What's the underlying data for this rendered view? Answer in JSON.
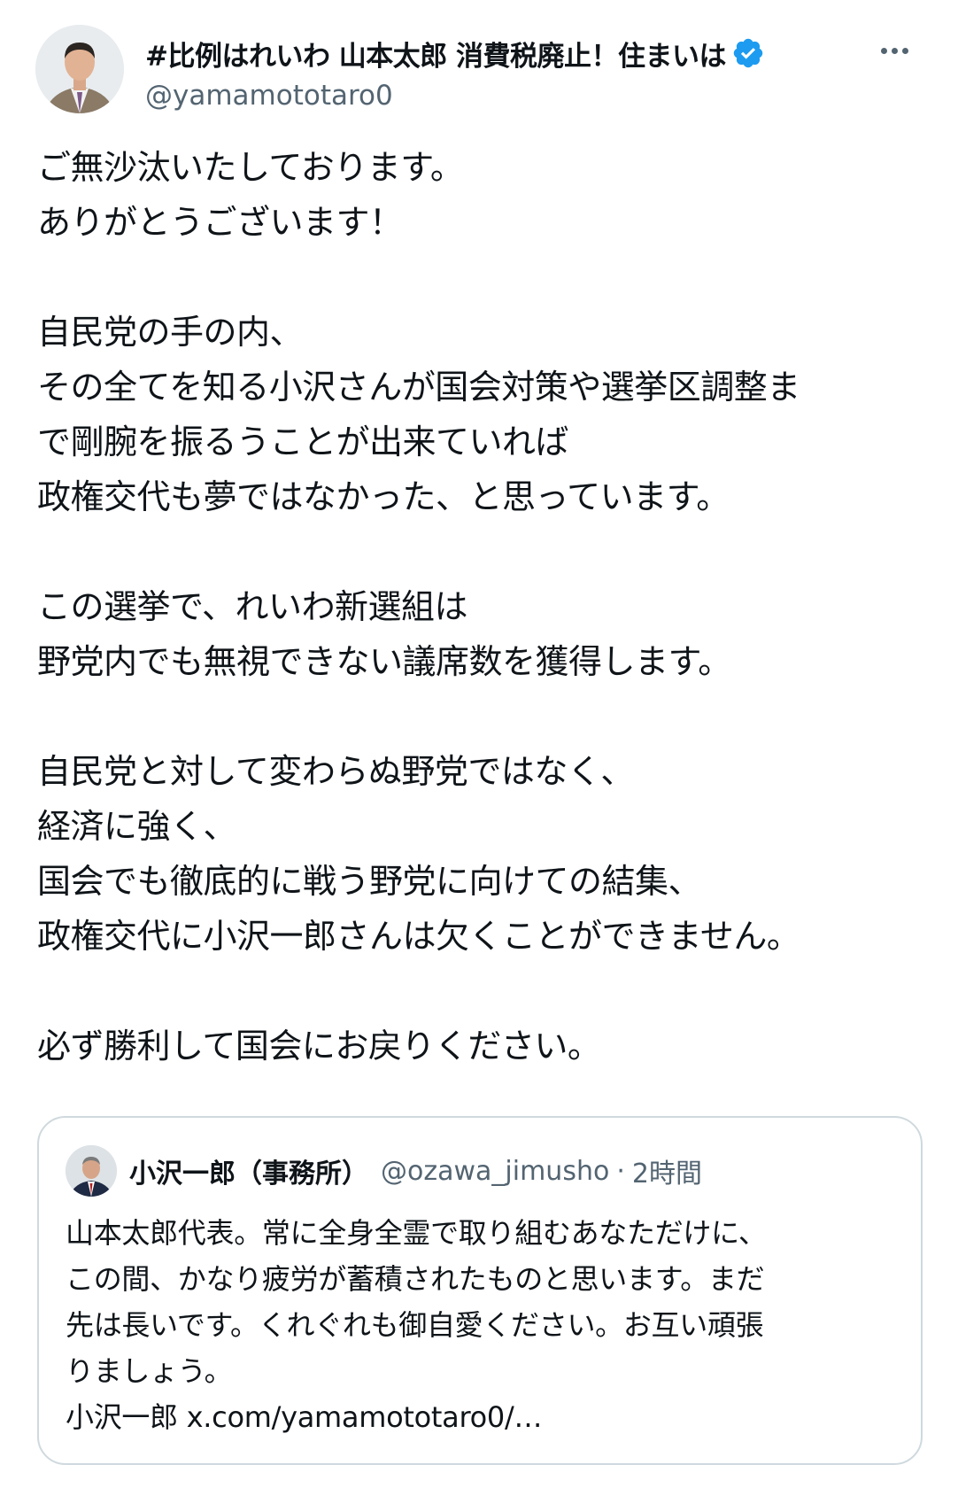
{
  "post": {
    "author": {
      "display_name": "#比例はれいわ 山本太郎 消費税廃止！住まいは",
      "handle": "@yamamototaro0",
      "verified_icon": "verified-badge-icon",
      "more_icon": "more-options-icon"
    },
    "body_lines": [
      "ご無沙汰いたしております。",
      "ありがとうございます！",
      "",
      "自民党の手の内、",
      "その全てを知る小沢さんが国会対策や選挙区調整ま",
      "で剛腕を振るうことが出来ていれば",
      "政権交代も夢ではなかった、と思っています。",
      "",
      "この選挙で、れいわ新選組は",
      "野党内でも無視できない議席数を獲得します。",
      "",
      "自民党と対して変わらぬ野党ではなく、",
      "経済に強く、",
      "国会でも徹底的に戦う野党に向けての結集、",
      "政権交代に小沢一郎さんは欠くことができません。",
      "",
      "必ず勝利して国会にお戻りください。"
    ]
  },
  "quoted_post": {
    "display_name": "小沢一郎（事務所）",
    "handle": "@ozawa_jimusho",
    "separator": "·",
    "time": "2時間",
    "body_lines": [
      "山本太郎代表。常に全身全霊で取り組むあなただけに、",
      "この間、かなり疲労が蓄積されたものと思います。まだ",
      "先は長いです。くれぐれも御自愛ください。お互い頑張",
      "りましょう。",
      "小沢一郎 x.com/yamamototaro0/…"
    ]
  },
  "colors": {
    "text": "#0f1419",
    "secondary": "#536471",
    "verified": "#1d9bf0",
    "border": "#cfd9de"
  }
}
